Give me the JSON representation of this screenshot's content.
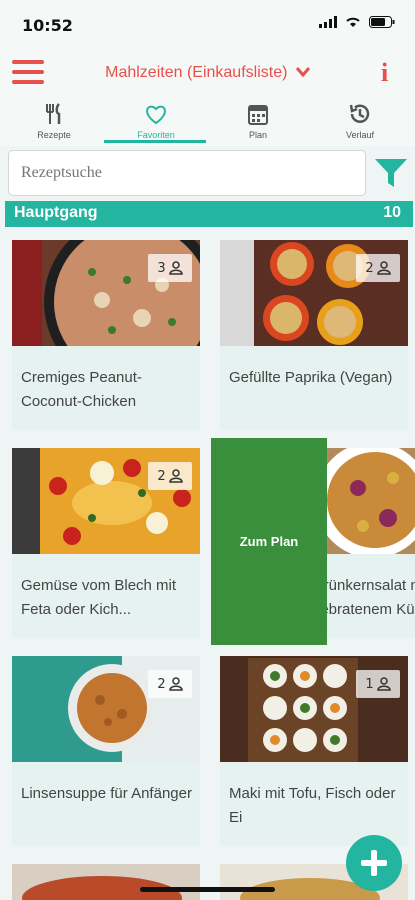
{
  "status_bar": {
    "time": "10:52"
  },
  "header": {
    "title": "Mahlzeiten (Einkaufsliste)"
  },
  "tabs": [
    {
      "label": "Rezepte",
      "icon": "cutlery-icon"
    },
    {
      "label": "Favoriten",
      "icon": "heart-icon",
      "active": true
    },
    {
      "label": "Plan",
      "icon": "calendar-icon"
    },
    {
      "label": "Verlauf",
      "icon": "history-icon"
    }
  ],
  "search": {
    "placeholder": "Rezeptsuche"
  },
  "category": {
    "name": "Hauptgang",
    "count": "10"
  },
  "recipes": [
    {
      "title": "Cremiges Peanut-Coconut-Chicken",
      "servings": "3"
    },
    {
      "title": "Gefüllte Paprika (Vegan)",
      "servings": "2"
    },
    {
      "title": "Gemüse vom Blech mit Feta oder Kich...",
      "servings": "2"
    },
    {
      "title": "Grünkernsalat mit gebratenem Kü...",
      "servings": ""
    },
    {
      "title": "Linsensuppe für Anfänger",
      "servings": "2"
    },
    {
      "title": "Maki mit Tofu, Fisch oder Ei",
      "servings": "1"
    }
  ],
  "swipe_action": {
    "label": "Zum Plan"
  },
  "colors": {
    "accent": "#23b5a0",
    "brand_red": "#e8504c",
    "plan_green": "#3a8f3d"
  }
}
